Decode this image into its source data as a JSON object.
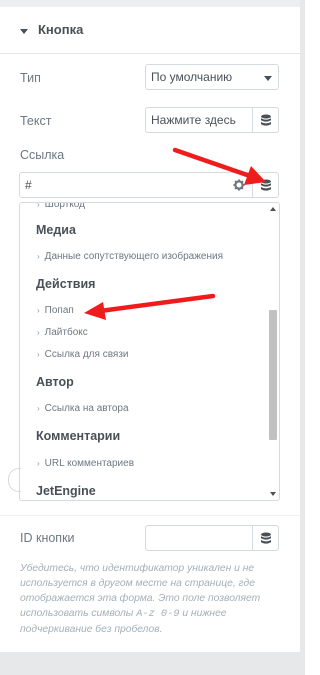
{
  "section": {
    "title": "Кнопка"
  },
  "type_field": {
    "label": "Тип",
    "value": "По умолчанию"
  },
  "text_field": {
    "label": "Текст",
    "value": "Нажмите здесь"
  },
  "link_field": {
    "label": "Ссылка",
    "value": "#"
  },
  "dropdown": {
    "partial_item": "Шорткод",
    "groups": [
      {
        "title": "Медиа",
        "items": [
          "Данные сопутствующего изображения"
        ]
      },
      {
        "title": "Действия",
        "items": [
          "Попап",
          "Лайтбокс",
          "Ссылка для связи"
        ]
      },
      {
        "title": "Автор",
        "items": [
          "Ссылка на автора"
        ]
      },
      {
        "title": "Комментарии",
        "items": [
          "URL комментариев"
        ]
      },
      {
        "title": "JetEngine",
        "items": []
      }
    ]
  },
  "id_field": {
    "label": "ID кнопки",
    "value": ""
  },
  "help": {
    "text_before": "Убедитесь, что идентификатор уникален и не используется в другом месте на странице, где отображается эта форма. Это поле позволяет использовать символы ",
    "code": "A-z 0-9",
    "text_after": " и нижнее подчеркивание без пробелов."
  },
  "colors": {
    "annotation_arrow": "#f01c1c",
    "label": "#6d7882",
    "border": "#d5dadf"
  }
}
